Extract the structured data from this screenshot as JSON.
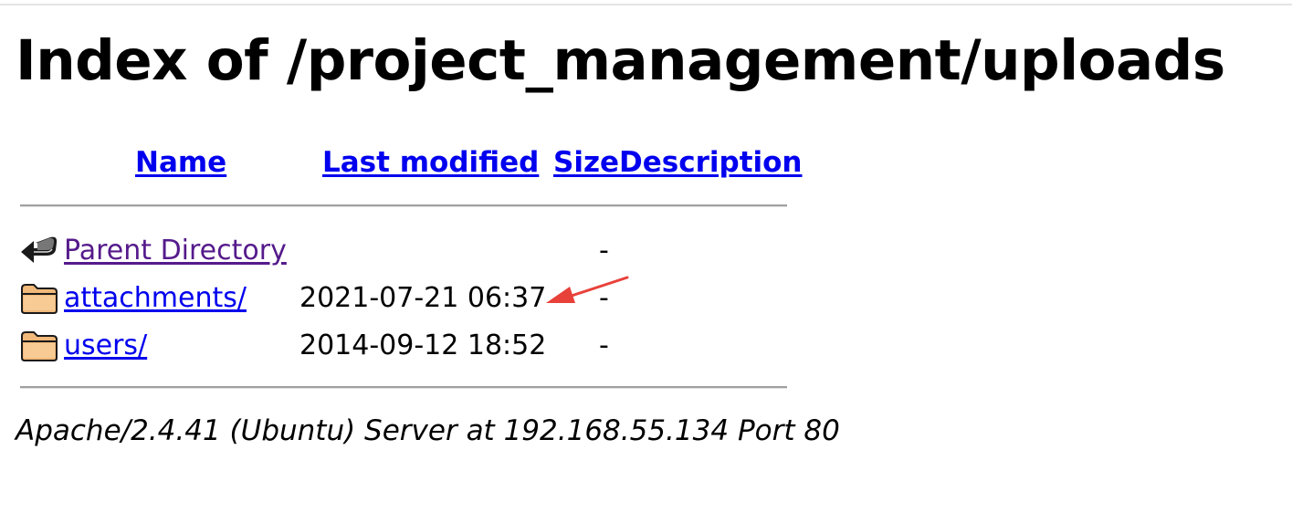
{
  "page": {
    "title": "Index of /project_management/uploads"
  },
  "table": {
    "headers": {
      "name": "Name",
      "last_modified": "Last modified",
      "size": "Size",
      "description": "Description"
    },
    "rows": [
      {
        "icon": "back-icon",
        "name": "Parent Directory",
        "last_modified": "",
        "size": "-",
        "visited": true
      },
      {
        "icon": "folder-icon",
        "name": "attachments/",
        "last_modified": "2021-07-21 06:37",
        "size": "-"
      },
      {
        "icon": "folder-icon",
        "name": "users/",
        "last_modified": "2014-09-12 18:52",
        "size": "-"
      }
    ]
  },
  "footer": {
    "server_signature": "Apache/2.4.41 (Ubuntu) Server at 192.168.55.134 Port 80"
  },
  "annotation": {
    "icon": "red-arrow-icon",
    "color": "#e8413a"
  },
  "colors": {
    "link": "#0000ee",
    "visited_link": "#551a8b"
  }
}
